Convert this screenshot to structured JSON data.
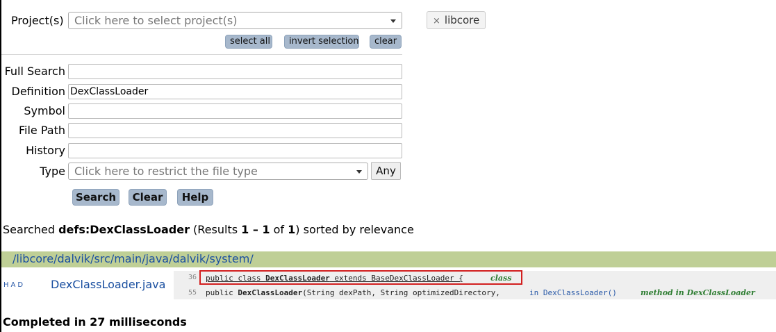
{
  "projects": {
    "label": "Project(s)",
    "placeholder": "Click here to select project(s)",
    "select_all": "select all",
    "invert_selection": "invert selection",
    "clear": "clear",
    "selected_chip": "libcore",
    "chip_remove": "×"
  },
  "form": {
    "full_search_label": "Full Search",
    "full_search_value": "",
    "definition_label": "Definition",
    "definition_value": "DexClassLoader",
    "symbol_label": "Symbol",
    "symbol_value": "",
    "file_path_label": "File Path",
    "file_path_value": "",
    "history_label": "History",
    "history_value": "",
    "type_label": "Type",
    "type_placeholder": "Click here to restrict the file type",
    "type_any": "Any",
    "search_btn": "Search",
    "clear_btn": "Clear",
    "help_btn": "Help"
  },
  "summary": {
    "prefix": "Searched ",
    "query": "defs:DexClassLoader",
    "results_open": " (Results ",
    "range": "1 – 1",
    "of": " of ",
    "total": "1",
    "suffix": ") sorted by relevance"
  },
  "results": {
    "directory": "/libcore/dalvik/src/main/java/dalvik/system/",
    "had": "HAD",
    "file": "DexClassLoader.java",
    "lines": [
      {
        "num": "36",
        "pre": "public class ",
        "bold": "DexClassLoader",
        "post": " extends BaseDexClassLoader {",
        "in_ref": "",
        "kind": "class"
      },
      {
        "num": "55",
        "pre": "public ",
        "bold": "DexClassLoader",
        "post": "(String dexPath, String optimizedDirectory,",
        "in_ref": "in DexClassLoader()",
        "kind": "method in DexClassLoader"
      }
    ]
  },
  "footer": {
    "completed": "Completed in 27 milliseconds"
  },
  "colors": {
    "button_bg": "#a7b8cc",
    "dir_bar": "#bfcf96",
    "link": "#1a4fa0",
    "highlight_border": "#d21f1f"
  }
}
